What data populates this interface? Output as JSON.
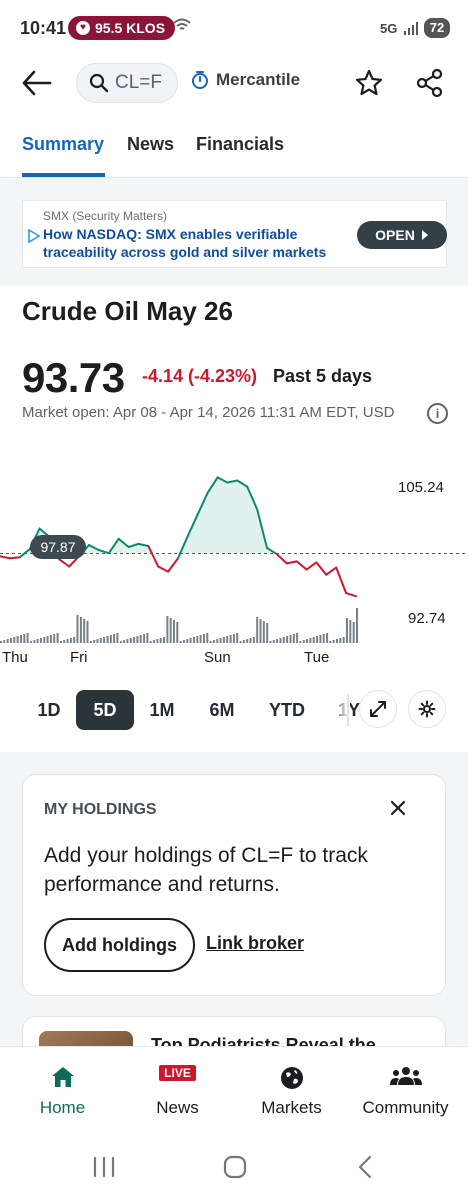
{
  "status_bar": {
    "time": "10:41",
    "radio": "95.5 KLOS",
    "network": "5G",
    "battery": "72"
  },
  "header": {
    "search_text": "CL=F",
    "exchange": "Mercantile"
  },
  "tabs": [
    {
      "label": "Summary",
      "active": true
    },
    {
      "label": "News",
      "active": false
    },
    {
      "label": "Financials",
      "active": false
    }
  ],
  "ad": {
    "sponsor": "SMX (Security Matters)",
    "headline": "How NASDAQ: SMX enables verifiable traceability across gold and silver markets",
    "button": "OPEN"
  },
  "quote": {
    "title": "Crude Oil May 26",
    "price": "93.73",
    "change": "-4.14 (-4.23%)",
    "period": "Past 5 days",
    "market_status": "Market open: Apr 08 - Apr 14, 2026 11:31 AM EDT, USD"
  },
  "chart_data": {
    "type": "line",
    "y_high_label": "105.24",
    "y_low_label": "92.74",
    "previous_close_label": "97.87",
    "previous_close": 97.87,
    "x_labels": [
      "Thu",
      "Fri",
      "Sun",
      "Tue"
    ],
    "values": [
      97.6,
      97.4,
      97.5,
      98.3,
      100.3,
      99.5,
      97.3,
      96.6,
      97.6,
      98.7,
      98.2,
      97.9,
      99.3,
      98.5,
      98.8,
      98.6,
      96.6,
      96.1,
      97.4,
      99.6,
      101.7,
      103.8,
      105.3,
      104.8,
      105.0,
      104.4,
      102.2,
      98.4,
      97.8,
      96.9,
      97.1,
      96.3,
      97.0,
      95.8,
      96.5,
      94.0,
      93.7
    ],
    "up_color": "#0b8a6a",
    "down_color": "#d0162c"
  },
  "ranges": {
    "items": [
      "1D",
      "5D",
      "1M",
      "6M",
      "YTD",
      "1Y"
    ],
    "active": "5D"
  },
  "holdings": {
    "title": "MY HOLDINGS",
    "text": "Add your holdings of CL=F to track performance and returns.",
    "add_button": "Add holdings",
    "link": "Link broker"
  },
  "promo": {
    "title": "Top Podiatrists Reveal the"
  },
  "bottom_nav": [
    {
      "label": "Home",
      "icon": "home-icon",
      "active": true
    },
    {
      "label": "News",
      "icon": "live-news-icon",
      "active": false
    },
    {
      "label": "Markets",
      "icon": "globe-icon",
      "active": false
    },
    {
      "label": "Community",
      "icon": "community-icon",
      "active": false
    }
  ],
  "live_badge": "LIVE",
  "colors": {
    "accent": "#1665c0",
    "brand_green": "#0d6b5a",
    "negative": "#d0162c"
  }
}
